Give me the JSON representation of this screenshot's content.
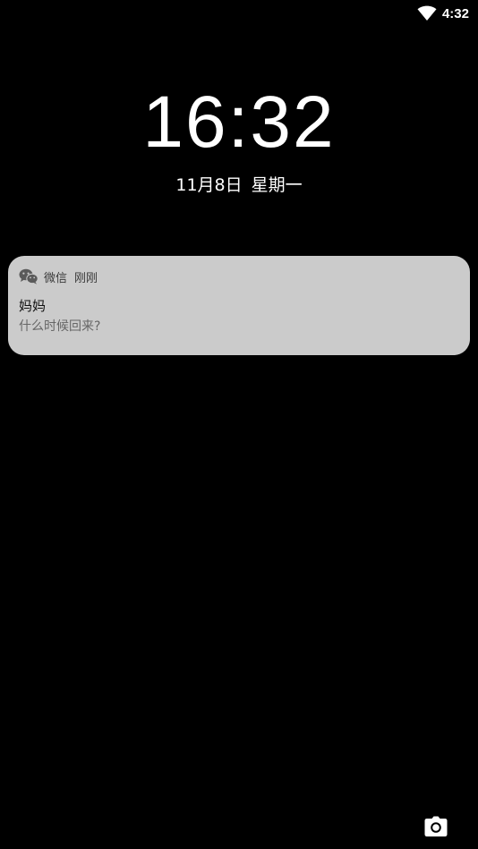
{
  "status_bar": {
    "time": "4:32",
    "wifi_icon": "wifi-icon"
  },
  "lockscreen": {
    "clock": "16:32",
    "date": "11月8日",
    "weekday": "星期一"
  },
  "notification": {
    "app_icon": "wechat-icon",
    "app_name": "微信",
    "time": "刚刚",
    "title": "妈妈",
    "message": "什么时候回来?",
    "background": "#cbcbcb"
  },
  "shortcuts": {
    "camera_icon": "camera-icon"
  }
}
